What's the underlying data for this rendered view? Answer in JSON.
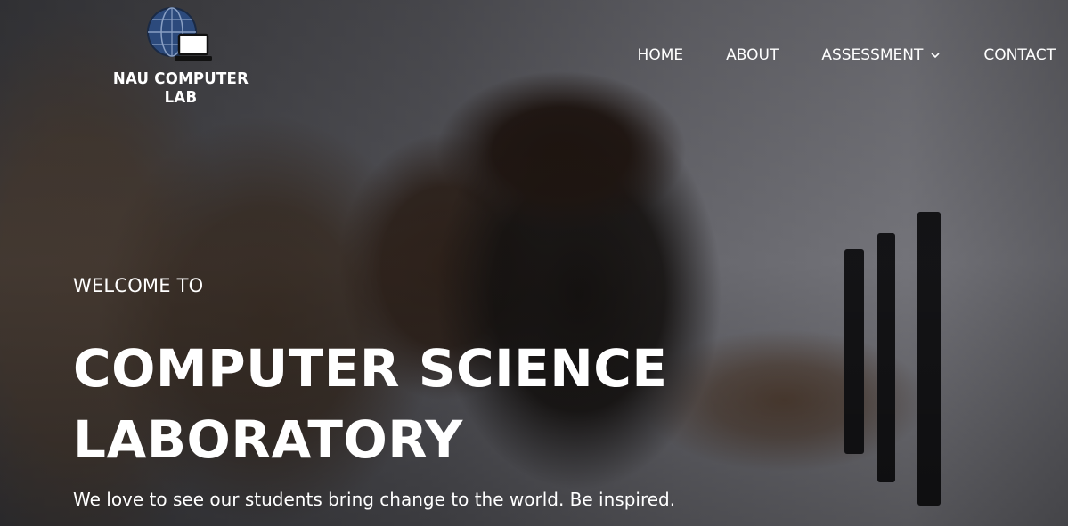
{
  "brand": {
    "name": "NAU COMPUTER LAB",
    "logo_icon": "globe-laptop-icon"
  },
  "nav": {
    "items": [
      {
        "label": "HOME"
      },
      {
        "label": "ABOUT"
      },
      {
        "label": "ASSESSMENT",
        "icon": "chevron-down-icon"
      },
      {
        "label": "CONTACT"
      }
    ]
  },
  "hero": {
    "eyebrow": "WELCOME TO",
    "title_line1": "COMPUTER SCIENCE",
    "title_line2": "LABORATORY",
    "tagline": "We love to see our students bring change to the world. Be inspired."
  },
  "colors": {
    "text": "#ffffff",
    "logo_globe": "#2c4a7c"
  }
}
